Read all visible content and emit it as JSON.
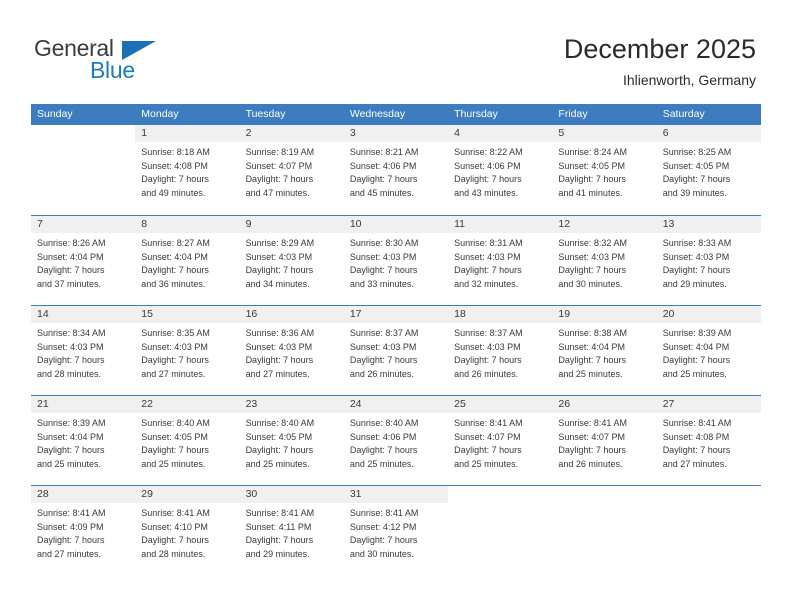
{
  "logo": {
    "word_one": "General",
    "word_two": "Blue",
    "triangle_icon": "triangle-icon",
    "brand_blue": "#1a7bc4",
    "brand_dark": "#3c3c3c"
  },
  "header": {
    "title": "December 2025",
    "subtitle": "Ihlienworth, Germany"
  },
  "colors": {
    "header_blue": "#3c7cbf",
    "day_band_gray": "#f0f0f0",
    "text": "#3a3a3a"
  },
  "calendar": {
    "weekdays": [
      "Sunday",
      "Monday",
      "Tuesday",
      "Wednesday",
      "Thursday",
      "Friday",
      "Saturday"
    ],
    "weeks": [
      [
        {
          "day": "",
          "sunrise": "",
          "sunset": "",
          "daylight_line1": "",
          "daylight_line2": ""
        },
        {
          "day": "1",
          "sunrise": "Sunrise: 8:18 AM",
          "sunset": "Sunset: 4:08 PM",
          "daylight_line1": "Daylight: 7 hours",
          "daylight_line2": "and 49 minutes."
        },
        {
          "day": "2",
          "sunrise": "Sunrise: 8:19 AM",
          "sunset": "Sunset: 4:07 PM",
          "daylight_line1": "Daylight: 7 hours",
          "daylight_line2": "and 47 minutes."
        },
        {
          "day": "3",
          "sunrise": "Sunrise: 8:21 AM",
          "sunset": "Sunset: 4:06 PM",
          "daylight_line1": "Daylight: 7 hours",
          "daylight_line2": "and 45 minutes."
        },
        {
          "day": "4",
          "sunrise": "Sunrise: 8:22 AM",
          "sunset": "Sunset: 4:06 PM",
          "daylight_line1": "Daylight: 7 hours",
          "daylight_line2": "and 43 minutes."
        },
        {
          "day": "5",
          "sunrise": "Sunrise: 8:24 AM",
          "sunset": "Sunset: 4:05 PM",
          "daylight_line1": "Daylight: 7 hours",
          "daylight_line2": "and 41 minutes."
        },
        {
          "day": "6",
          "sunrise": "Sunrise: 8:25 AM",
          "sunset": "Sunset: 4:05 PM",
          "daylight_line1": "Daylight: 7 hours",
          "daylight_line2": "and 39 minutes."
        }
      ],
      [
        {
          "day": "7",
          "sunrise": "Sunrise: 8:26 AM",
          "sunset": "Sunset: 4:04 PM",
          "daylight_line1": "Daylight: 7 hours",
          "daylight_line2": "and 37 minutes."
        },
        {
          "day": "8",
          "sunrise": "Sunrise: 8:27 AM",
          "sunset": "Sunset: 4:04 PM",
          "daylight_line1": "Daylight: 7 hours",
          "daylight_line2": "and 36 minutes."
        },
        {
          "day": "9",
          "sunrise": "Sunrise: 8:29 AM",
          "sunset": "Sunset: 4:03 PM",
          "daylight_line1": "Daylight: 7 hours",
          "daylight_line2": "and 34 minutes."
        },
        {
          "day": "10",
          "sunrise": "Sunrise: 8:30 AM",
          "sunset": "Sunset: 4:03 PM",
          "daylight_line1": "Daylight: 7 hours",
          "daylight_line2": "and 33 minutes."
        },
        {
          "day": "11",
          "sunrise": "Sunrise: 8:31 AM",
          "sunset": "Sunset: 4:03 PM",
          "daylight_line1": "Daylight: 7 hours",
          "daylight_line2": "and 32 minutes."
        },
        {
          "day": "12",
          "sunrise": "Sunrise: 8:32 AM",
          "sunset": "Sunset: 4:03 PM",
          "daylight_line1": "Daylight: 7 hours",
          "daylight_line2": "and 30 minutes."
        },
        {
          "day": "13",
          "sunrise": "Sunrise: 8:33 AM",
          "sunset": "Sunset: 4:03 PM",
          "daylight_line1": "Daylight: 7 hours",
          "daylight_line2": "and 29 minutes."
        }
      ],
      [
        {
          "day": "14",
          "sunrise": "Sunrise: 8:34 AM",
          "sunset": "Sunset: 4:03 PM",
          "daylight_line1": "Daylight: 7 hours",
          "daylight_line2": "and 28 minutes."
        },
        {
          "day": "15",
          "sunrise": "Sunrise: 8:35 AM",
          "sunset": "Sunset: 4:03 PM",
          "daylight_line1": "Daylight: 7 hours",
          "daylight_line2": "and 27 minutes."
        },
        {
          "day": "16",
          "sunrise": "Sunrise: 8:36 AM",
          "sunset": "Sunset: 4:03 PM",
          "daylight_line1": "Daylight: 7 hours",
          "daylight_line2": "and 27 minutes."
        },
        {
          "day": "17",
          "sunrise": "Sunrise: 8:37 AM",
          "sunset": "Sunset: 4:03 PM",
          "daylight_line1": "Daylight: 7 hours",
          "daylight_line2": "and 26 minutes."
        },
        {
          "day": "18",
          "sunrise": "Sunrise: 8:37 AM",
          "sunset": "Sunset: 4:03 PM",
          "daylight_line1": "Daylight: 7 hours",
          "daylight_line2": "and 26 minutes."
        },
        {
          "day": "19",
          "sunrise": "Sunrise: 8:38 AM",
          "sunset": "Sunset: 4:04 PM",
          "daylight_line1": "Daylight: 7 hours",
          "daylight_line2": "and 25 minutes."
        },
        {
          "day": "20",
          "sunrise": "Sunrise: 8:39 AM",
          "sunset": "Sunset: 4:04 PM",
          "daylight_line1": "Daylight: 7 hours",
          "daylight_line2": "and 25 minutes."
        }
      ],
      [
        {
          "day": "21",
          "sunrise": "Sunrise: 8:39 AM",
          "sunset": "Sunset: 4:04 PM",
          "daylight_line1": "Daylight: 7 hours",
          "daylight_line2": "and 25 minutes."
        },
        {
          "day": "22",
          "sunrise": "Sunrise: 8:40 AM",
          "sunset": "Sunset: 4:05 PM",
          "daylight_line1": "Daylight: 7 hours",
          "daylight_line2": "and 25 minutes."
        },
        {
          "day": "23",
          "sunrise": "Sunrise: 8:40 AM",
          "sunset": "Sunset: 4:05 PM",
          "daylight_line1": "Daylight: 7 hours",
          "daylight_line2": "and 25 minutes."
        },
        {
          "day": "24",
          "sunrise": "Sunrise: 8:40 AM",
          "sunset": "Sunset: 4:06 PM",
          "daylight_line1": "Daylight: 7 hours",
          "daylight_line2": "and 25 minutes."
        },
        {
          "day": "25",
          "sunrise": "Sunrise: 8:41 AM",
          "sunset": "Sunset: 4:07 PM",
          "daylight_line1": "Daylight: 7 hours",
          "daylight_line2": "and 25 minutes."
        },
        {
          "day": "26",
          "sunrise": "Sunrise: 8:41 AM",
          "sunset": "Sunset: 4:07 PM",
          "daylight_line1": "Daylight: 7 hours",
          "daylight_line2": "and 26 minutes."
        },
        {
          "day": "27",
          "sunrise": "Sunrise: 8:41 AM",
          "sunset": "Sunset: 4:08 PM",
          "daylight_line1": "Daylight: 7 hours",
          "daylight_line2": "and 27 minutes."
        }
      ],
      [
        {
          "day": "28",
          "sunrise": "Sunrise: 8:41 AM",
          "sunset": "Sunset: 4:09 PM",
          "daylight_line1": "Daylight: 7 hours",
          "daylight_line2": "and 27 minutes."
        },
        {
          "day": "29",
          "sunrise": "Sunrise: 8:41 AM",
          "sunset": "Sunset: 4:10 PM",
          "daylight_line1": "Daylight: 7 hours",
          "daylight_line2": "and 28 minutes."
        },
        {
          "day": "30",
          "sunrise": "Sunrise: 8:41 AM",
          "sunset": "Sunset: 4:11 PM",
          "daylight_line1": "Daylight: 7 hours",
          "daylight_line2": "and 29 minutes."
        },
        {
          "day": "31",
          "sunrise": "Sunrise: 8:41 AM",
          "sunset": "Sunset: 4:12 PM",
          "daylight_line1": "Daylight: 7 hours",
          "daylight_line2": "and 30 minutes."
        },
        {
          "day": "",
          "sunrise": "",
          "sunset": "",
          "daylight_line1": "",
          "daylight_line2": ""
        },
        {
          "day": "",
          "sunrise": "",
          "sunset": "",
          "daylight_line1": "",
          "daylight_line2": ""
        },
        {
          "day": "",
          "sunrise": "",
          "sunset": "",
          "daylight_line1": "",
          "daylight_line2": ""
        }
      ]
    ]
  }
}
